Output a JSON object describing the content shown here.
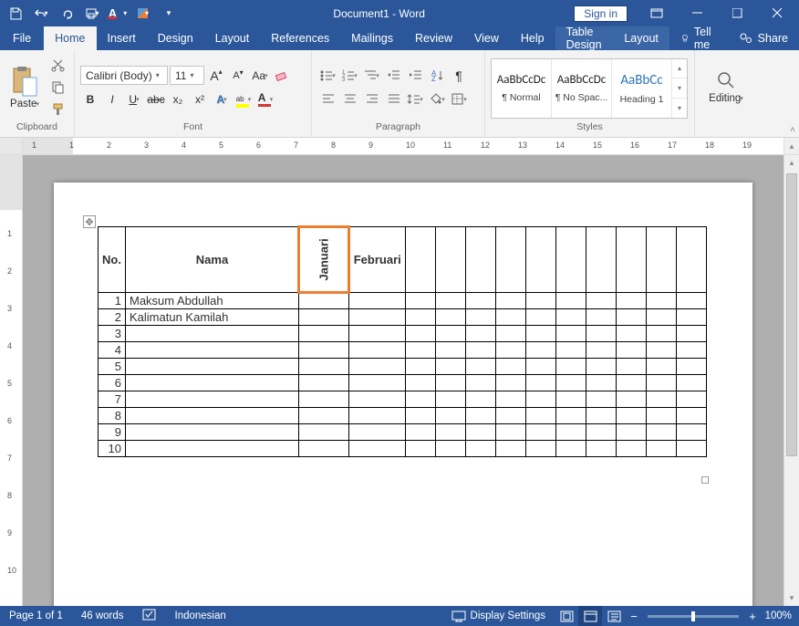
{
  "title_bar": {
    "title": "Document1 - Word",
    "signin": "Sign in"
  },
  "tabs": {
    "file": "File",
    "home": "Home",
    "insert": "Insert",
    "design": "Design",
    "layout": "Layout",
    "references": "References",
    "mailings": "Mailings",
    "review": "Review",
    "view": "View",
    "help": "Help",
    "table_design": "Table Design",
    "table_layout": "Layout",
    "tellme": "Tell me",
    "share": "Share"
  },
  "ribbon": {
    "clipboard": {
      "label": "Clipboard",
      "paste": "Paste"
    },
    "font": {
      "label": "Font",
      "family": "Calibri (Body)",
      "size": "11",
      "bold": "B",
      "italic": "I",
      "underline": "U",
      "strike": "abc",
      "sub": "x₂",
      "sup": "x²",
      "aa_case": "Aa",
      "grow": "A",
      "shrink": "A"
    },
    "paragraph": {
      "label": "Paragraph"
    },
    "styles": {
      "label": "Styles",
      "items": [
        {
          "preview": "AaBbCcDc",
          "name": "¶ Normal"
        },
        {
          "preview": "AaBbCcDc",
          "name": "¶ No Spac..."
        },
        {
          "preview": "AaBbCc",
          "name": "Heading 1"
        }
      ]
    },
    "editing": {
      "label": "Editing"
    }
  },
  "ruler": {
    "major": [
      "1",
      "1",
      "2",
      "3",
      "4",
      "5",
      "6",
      "7",
      "8",
      "9",
      "10",
      "11",
      "12",
      "13",
      "14",
      "15",
      "16",
      "17",
      "18",
      "19"
    ],
    "vmajor": [
      "",
      "1",
      "2",
      "3",
      "4",
      "5",
      "6",
      "7",
      "8",
      "9",
      "10"
    ]
  },
  "document": {
    "headers": {
      "no": "No.",
      "nama": "Nama",
      "jan": "Januari",
      "feb": "Februari"
    },
    "rows": [
      {
        "no": "1",
        "nama": "Maksum Abdullah"
      },
      {
        "no": "2",
        "nama": "Kalimatun Kamilah"
      },
      {
        "no": "3",
        "nama": ""
      },
      {
        "no": "4",
        "nama": ""
      },
      {
        "no": "5",
        "nama": ""
      },
      {
        "no": "6",
        "nama": ""
      },
      {
        "no": "7",
        "nama": ""
      },
      {
        "no": "8",
        "nama": ""
      },
      {
        "no": "9",
        "nama": ""
      },
      {
        "no": "10",
        "nama": ""
      }
    ],
    "blank_cols": 10
  },
  "status": {
    "page": "Page 1 of 1",
    "words": "46 words",
    "language": "Indonesian",
    "display": "Display Settings",
    "zoom": "100%"
  }
}
